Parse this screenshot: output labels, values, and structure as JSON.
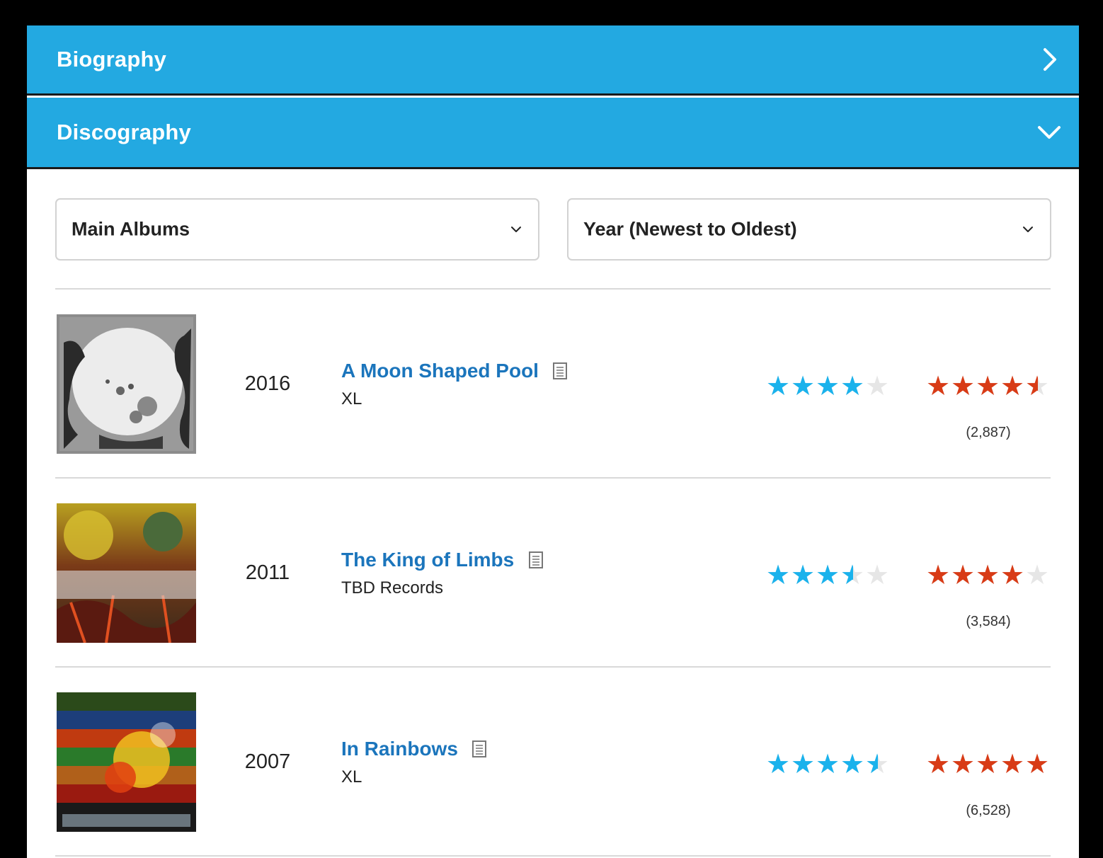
{
  "accordion": {
    "biography": {
      "title": "Biography",
      "icon": "chevron-right-icon"
    },
    "discography": {
      "title": "Discography",
      "icon": "chevron-down-icon"
    }
  },
  "filters": {
    "type_select": {
      "value": "Main Albums"
    },
    "sort_select": {
      "value": "Year (Newest to Oldest)"
    }
  },
  "colors": {
    "header": "#23a9e1",
    "link": "#1b75bc",
    "critic_star": "#1ab2ec",
    "user_star": "#d83b16"
  },
  "albums": [
    {
      "year": "2016",
      "title": "A Moon Shaped Pool",
      "label": "XL",
      "critic_rating": 4.0,
      "user_rating": 4.5,
      "user_count": "(2,887)"
    },
    {
      "year": "2011",
      "title": "The King of Limbs",
      "label": "TBD Records",
      "critic_rating": 3.5,
      "user_rating": 4.0,
      "user_count": "(3,584)"
    },
    {
      "year": "2007",
      "title": "In Rainbows",
      "label": "XL",
      "critic_rating": 4.5,
      "user_rating": 5.0,
      "user_count": "(6,528)"
    }
  ]
}
